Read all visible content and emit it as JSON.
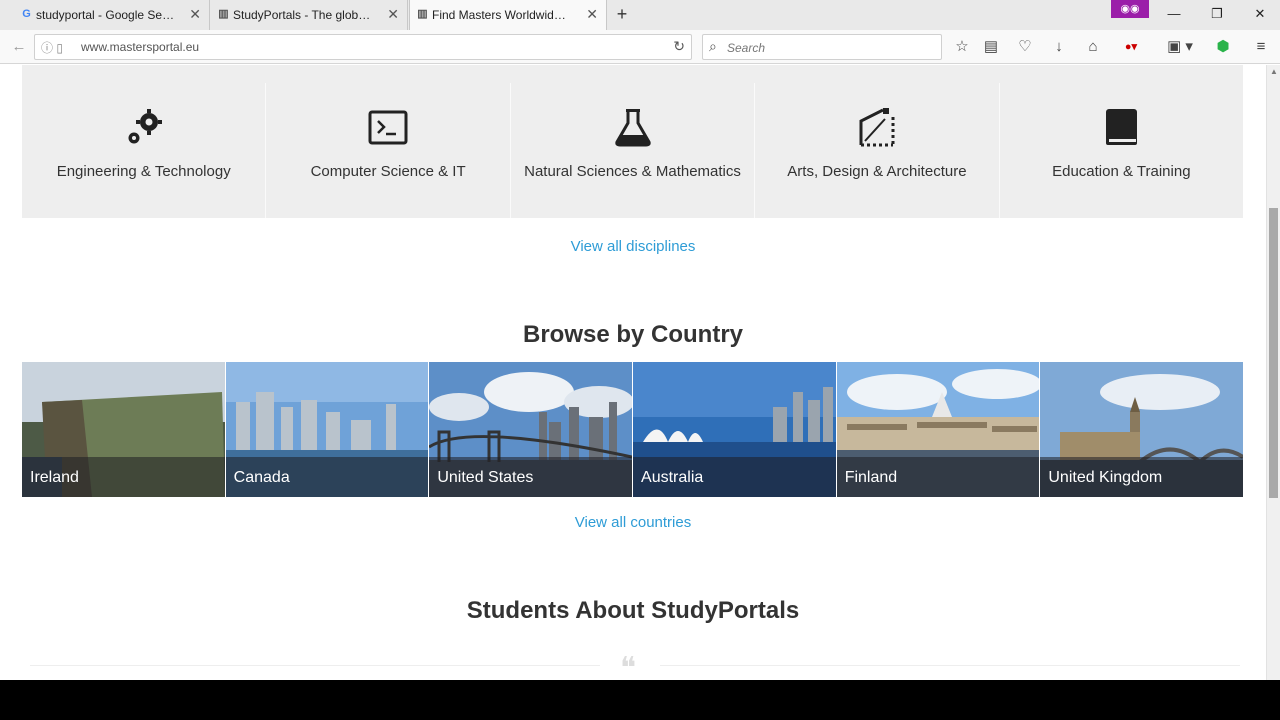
{
  "browser": {
    "tabs": [
      {
        "title": "studyportal - Google Search",
        "favicon": "google-icon"
      },
      {
        "title": "StudyPortals - The global ...",
        "favicon": "studyportals-icon"
      },
      {
        "title": "Find Masters Worldwide: a...",
        "favicon": "studyportals-icon",
        "active": true
      }
    ],
    "url": "www.mastersportal.eu",
    "search_placeholder": "Search"
  },
  "page": {
    "disciplines": [
      {
        "label": "Engineering & Technology",
        "icon": "gears-icon"
      },
      {
        "label": "Computer Science & IT",
        "icon": "terminal-icon"
      },
      {
        "label": "Natural Sciences & Mathematics",
        "icon": "flask-icon"
      },
      {
        "label": "Arts, Design & Architecture",
        "icon": "design-tool-icon"
      },
      {
        "label": "Education & Training",
        "icon": "book-icon"
      }
    ],
    "view_all_disciplines": "View all disciplines",
    "browse_by_country_title": "Browse by Country",
    "countries": [
      {
        "name": "Ireland"
      },
      {
        "name": "Canada"
      },
      {
        "name": "United States"
      },
      {
        "name": "Australia"
      },
      {
        "name": "Finland"
      },
      {
        "name": "United Kingdom"
      }
    ],
    "view_all_countries": "View all countries",
    "students_title": "Students About StudyPortals"
  }
}
